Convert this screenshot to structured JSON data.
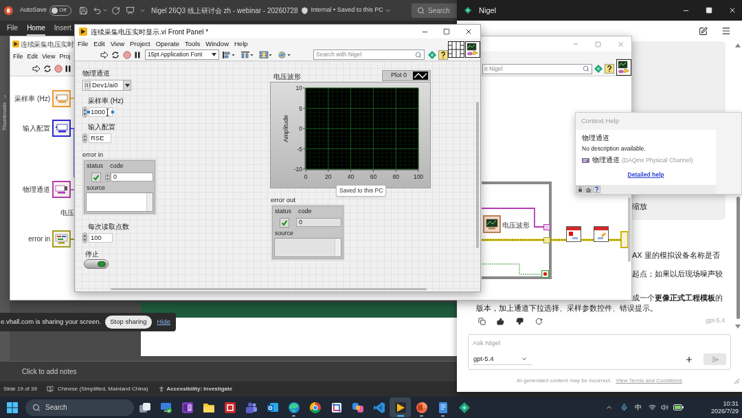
{
  "powerpoint": {
    "autosave": {
      "label": "AutoSave",
      "state": "Off",
      "on": false
    },
    "document_title": "Nigel 26Q3 线上研讨会 zh - webinar - 20260728",
    "save_status": "Internal • Saved to this PC",
    "search": {
      "placeholder": "Search"
    },
    "ribbon_tabs": [
      {
        "label": "File",
        "selected": false
      },
      {
        "label": "Home",
        "selected": true
      },
      {
        "label": "Insert",
        "selected": false
      }
    ],
    "thumbnails_label": "Thumbnails",
    "notes": {
      "placeholder": "Click to add notes"
    },
    "status_bar": {
      "slide": "Slide 19 of 39",
      "language": "Chinese (Simplified, Mainland China)",
      "accessibility": "Accessibility: Investigate"
    }
  },
  "front_panel": {
    "title": "连续采集电压实时显示.vi Front Panel *",
    "menu": [
      "File",
      "Edit",
      "View",
      "Project",
      "Operate",
      "Tools",
      "Window",
      "Help"
    ],
    "font_select": "15pt Application Font",
    "search": {
      "placeholder": "Search with Nigel"
    },
    "controls": [
      {
        "kind": "channel",
        "label": "物理通道",
        "value": "Dev1/ai0",
        "editing": false
      },
      {
        "kind": "numeric",
        "label": "采样率 (Hz)",
        "value": "1000",
        "editing": true
      },
      {
        "kind": "ring",
        "label": "输入配置",
        "value": "RSE",
        "editing": false
      },
      {
        "kind": "error_cluster",
        "label": "error in",
        "status_label": "status",
        "code_label": "code",
        "code": "0",
        "source_label": "source",
        "status_ok": true,
        "editing": false
      },
      {
        "kind": "numeric",
        "label": "每次读取点数",
        "value": "100",
        "editing": false
      },
      {
        "kind": "stop_button",
        "label": "停止",
        "editing": false
      }
    ],
    "graph": {
      "label": "电压波形",
      "chart_data": {
        "type": "line",
        "ylabel": "Amplitude",
        "categories": [
          "0",
          "20",
          "40",
          "60",
          "80",
          "100"
        ],
        "ylim": [
          -10,
          10
        ],
        "yticks": [
          -10,
          -5,
          0,
          5,
          10
        ],
        "grid": true,
        "series": [
          {
            "name": "Plot 0",
            "color": "#ffffff",
            "values": [
              null,
              null,
              null,
              null,
              null,
              null
            ]
          }
        ]
      }
    },
    "error_out": {
      "label": "error out",
      "status_label": "status",
      "code_label": "code",
      "code": "0",
      "source_label": "source",
      "status_ok": true
    },
    "tooltip": "Saved to this PC"
  },
  "block_diagram": {
    "title": "连续采集电压实时",
    "menu": [
      "File",
      "Edit",
      "View",
      "Proj"
    ],
    "search": {
      "placeholder": "n Nigel"
    },
    "terminals": [
      {
        "kind": "numeric",
        "label": "采样率 (Hz)",
        "color": "#f09a2e"
      },
      {
        "kind": "ring",
        "label": "输入配置",
        "color": "#2b2bd6"
      },
      {
        "kind": "channel",
        "label": "物理通道",
        "color": "#b23cb4"
      },
      {
        "kind": "cluster",
        "label": "error in",
        "color": "#a4a01e"
      }
    ],
    "partial_label": "电压",
    "indicator_label": "电压波形"
  },
  "nigel": {
    "title": "Nigel",
    "user_message": "缩放",
    "reply_fragments": [
      "AX 里的模拟设备名称是否",
      "起点；如果以后现场噪声较",
      "成一个**更像正式工程模板**的"
    ],
    "reply_last_line": "版本，加上通道下拉选择、采样参数控件、错误提示。",
    "reply_model": "gpt-5.4",
    "input": {
      "placeholder": "Ask Nigel",
      "model": "gpt-5.4"
    },
    "footer": {
      "notice": "AI-generated content may be incorrect.",
      "link": "View Terms and Conditions"
    }
  },
  "context_help": {
    "title": "Context Help",
    "heading": "物理通道",
    "description": "No description available.",
    "type_label": "物理通道",
    "type_detail": "(DAQmx Physical Channel)",
    "link": "Detailed help"
  },
  "screen_share": {
    "message": "e.vhall.com is sharing your screen.",
    "stop_label": "Stop sharing",
    "hide_label": "Hide"
  },
  "taskbar": {
    "search": {
      "placeholder": "Search"
    },
    "apps": [
      {
        "kind": "task_view",
        "running": false,
        "selected": false
      },
      {
        "kind": "monitor",
        "running": false,
        "selected": false
      },
      {
        "kind": "notebook",
        "running": false,
        "selected": false
      },
      {
        "kind": "folder",
        "running": false,
        "selected": false
      },
      {
        "kind": "square",
        "running": false,
        "selected": false
      },
      {
        "kind": "people",
        "running": false,
        "selected": false
      },
      {
        "kind": "mail",
        "running": false,
        "selected": false
      },
      {
        "kind": "swirl",
        "running": true,
        "selected": false
      },
      {
        "kind": "ring",
        "running": false,
        "selected": false
      },
      {
        "kind": "crop",
        "running": false,
        "selected": false
      },
      {
        "kind": "knot",
        "running": false,
        "selected": false
      },
      {
        "kind": "code",
        "running": false,
        "selected": false
      },
      {
        "kind": "play",
        "running": true,
        "selected": true
      },
      {
        "kind": "disc",
        "running": true,
        "selected": false
      },
      {
        "kind": "notepad",
        "running": true,
        "selected": false
      },
      {
        "kind": "diamond",
        "running": false,
        "selected": false
      }
    ],
    "tray": {
      "ime": "中",
      "time": "10:31",
      "date": "2026/7/29"
    }
  }
}
